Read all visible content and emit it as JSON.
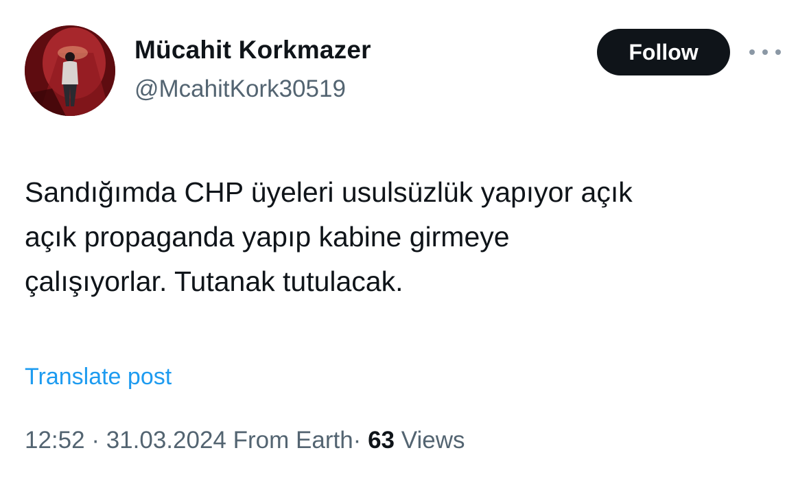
{
  "user": {
    "display_name": "Mücahit Korkmazer",
    "handle": "@McahitKork30519"
  },
  "actions": {
    "follow_label": "Follow"
  },
  "post": {
    "lines": [
      "Sandığımda CHP üyeleri usulsüzlük yapıyor açık",
      "açık propaganda yapıp kabine girmeye",
      "çalışıyorlar. Tutanak tutulacak."
    ],
    "translate_label": "Translate post"
  },
  "meta": {
    "time": "12:52",
    "separator": "·",
    "date": "31.03.2024",
    "source": "From Earth",
    "views_count": "63",
    "views_label": "Views"
  },
  "icons": {
    "more": "more-horizontal-icon"
  },
  "colors": {
    "follow_bg": "#0f1419",
    "link": "#1d9bf0",
    "secondary_text": "#536471"
  }
}
